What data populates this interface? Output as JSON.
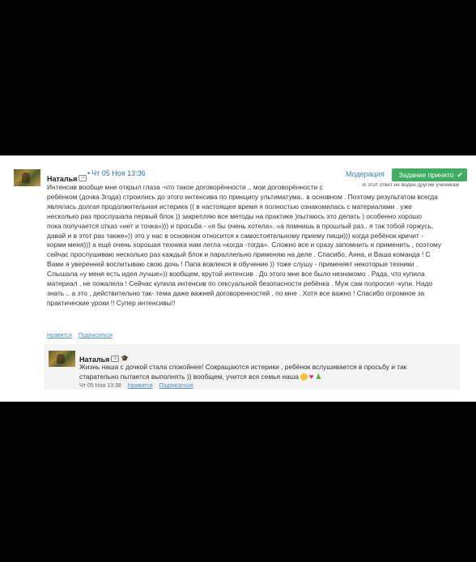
{
  "comment": {
    "author": "Наталья",
    "date": "Чт 05 Ноя 13:36",
    "moderation_label": "Модерация",
    "status_label": "Задание принято",
    "visibility_note": "этот ответ не виден другим ученикам",
    "text_lines": [
      "Интенсив вообще мне открыл глаза -что такое договорённости .. мои договорённости с",
      "ребёнком (дочка 3года) строились до этого интенсива по принципу ультиматума.. в основном . Поэтому результатом всегда",
      "являлась долгая продолжительная истерика (( в настоящее время я полностью ознакомилась с материалами . уже",
      "несколько раз прослушала первый блок )) закрепляю все методы на практике )пытаюсь это делать ) особенно хорошо",
      "пока получается отказ «нет и точка»))) и просьба - «я бы очень хотела», «а помнишь в прошлый раз.. я так тобой горжусь,",
      "давай и в этот раз также»)) это у нас в основном относится к самостоятельному приему пищи))) когда ребёнок кричит -",
      "корми меня))) а ещё очень хорошая техника нам легла «когда -тогда». Сложно все и сразу запомнить и применить , поэтому",
      "сейчас прослушиваю несколько раз каждый блок и параллельно применяю на деле . Спасибо, Анна, и Ваша команда ! С",
      "Вами я уверенней воспитываю свою дочь ! Папа вовлекся в обучение )) тоже слушу - применяет некоторые техники .",
      "Слышала «у меня есть идея лучше»)) вообщем, крутой интенсив . До этого мне все было незнакомо . Рада, что купила",
      "материал , не пожалела ! Сейчас купила интенсив по сексуальной безопасности ребёнка . Муж сам попросил -купи. Надо",
      "знать .. а это , действительно так- тема даже важней договоренностей , по мне . Хотя все важно ! Спасибо огромное за",
      "практические уроки !! Супер интенсивы!!"
    ],
    "like_label": "Нравится",
    "subscribe_label": "Подписаться"
  },
  "reply": {
    "author": "Наталья",
    "text_lines": [
      "Жизнь наша с дочкой стала спокойнее! Сокращаются истерики , ребёнок вслушивается в просьбу и так",
      "старательно пытается выполнять )) вообщем, учится вся семья наша"
    ],
    "date": "Чт 05 Ноя 13:38",
    "like_label": "Нравится",
    "subscribe_label": "Подписаться"
  },
  "colors": {
    "status_green": "#3fae62",
    "link_blue": "#3b82c4"
  },
  "icons": [
    "message-icon",
    "check-icon",
    "graduation-cap-icon",
    "lock-icon",
    "smile-emoji",
    "heart-emoji",
    "family-emoji"
  ]
}
